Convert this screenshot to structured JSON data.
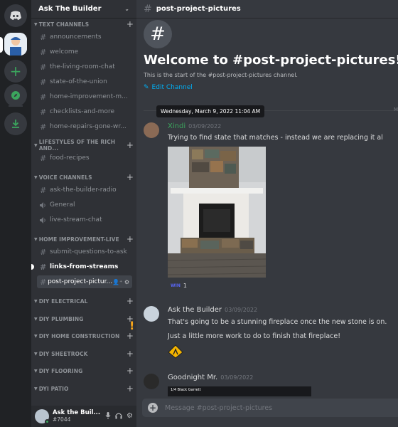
{
  "server": {
    "name": "Ask The Builder"
  },
  "categories": [
    {
      "key": "text",
      "label": "TEXT CHANNELS"
    },
    {
      "key": "lifestyles",
      "label": "LIFESTYLES OF THE RICH AND..."
    },
    {
      "key": "voice",
      "label": "VOICE CHANNELS"
    },
    {
      "key": "home_improvement",
      "label": "HOME IMPROVEMENT-LIVE"
    },
    {
      "key": "diy_electrical",
      "label": "DIY ELECTRICAL"
    },
    {
      "key": "diy_plumbing",
      "label": "DIY PLUMBING"
    },
    {
      "key": "diy_home_construction",
      "label": "DIY HOME CONSTRUCTION"
    },
    {
      "key": "diy_sheetrock",
      "label": "DIY SHEETROCK"
    },
    {
      "key": "diy_flooring",
      "label": "DIY FLOORING"
    },
    {
      "key": "dyi_patio",
      "label": "DYI PATIO"
    }
  ],
  "channels": {
    "text": [
      "announcements",
      "welcome",
      "the-living-room-chat",
      "state-of-the-union",
      "home-improvement-m...",
      "checklists-and-more",
      "home-repairs-gone-wr..."
    ],
    "lifestyles": [
      "food-recipes"
    ],
    "voice": [
      "ask-the-builder-radio",
      "General",
      "live-stream-chat"
    ],
    "home_improvement": [
      "submit-questions-to-ask",
      "links-from-streams",
      "post-project-pictur..."
    ]
  },
  "user": {
    "name": "Ask the Buil...",
    "tag": "#7044"
  },
  "topbar": {
    "channel": "post-project-pictures"
  },
  "welcome": {
    "title": "Welcome to #post-project-pictures!",
    "subtitle": "This is the start of the #post-project-pictures channel.",
    "edit_label": "Edit Channel"
  },
  "tooltip": "Wednesday, March 9, 2022 11:04 AM",
  "date_edge": "M",
  "messages": [
    {
      "author": "Xindi",
      "author_color": "#3ba55d",
      "timestamp": "03/09/2022",
      "lines": [
        "Trying to find state that  matches - instead we are replacing it al"
      ],
      "reaction": {
        "emoji": "WIN",
        "count": "1"
      }
    },
    {
      "author": "Ask the Builder",
      "author_color": "#dcddde",
      "timestamp": "03/09/2022",
      "lines": [
        "That's going to be a stunning fireplace once the new stone is on.",
        "Just a little more work to do to finish that fireplace!"
      ]
    },
    {
      "author": "Goodnight Mr.",
      "author_color": "#dcddde",
      "timestamp": "03/09/2022",
      "embed": "1/4 Black Garrett"
    }
  ],
  "composer": {
    "placeholder": "Message #post-project-pictures"
  },
  "colors": {
    "accent": "#00aff4",
    "online": "#3ba55d"
  }
}
